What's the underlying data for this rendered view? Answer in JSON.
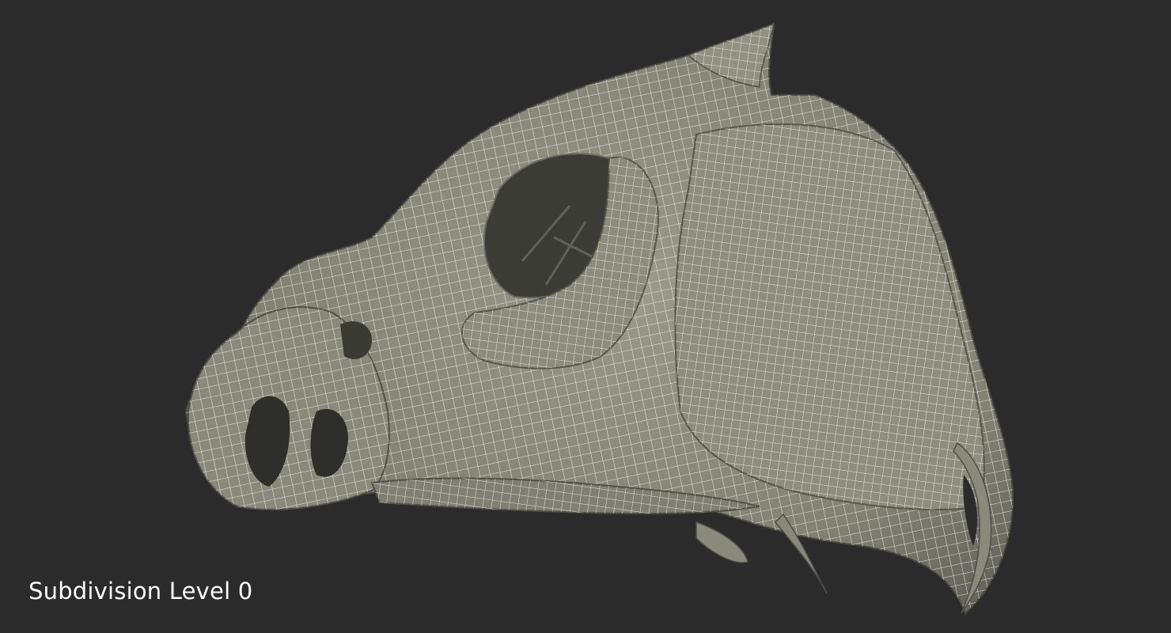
{
  "caption": "Subdivision Level 0",
  "colors": {
    "background": "#2b2b2b",
    "surface": "#8a8a7c",
    "surface_dark": "#5f5f55",
    "wire": "#f2f2ea",
    "caption": "#ffffff"
  }
}
